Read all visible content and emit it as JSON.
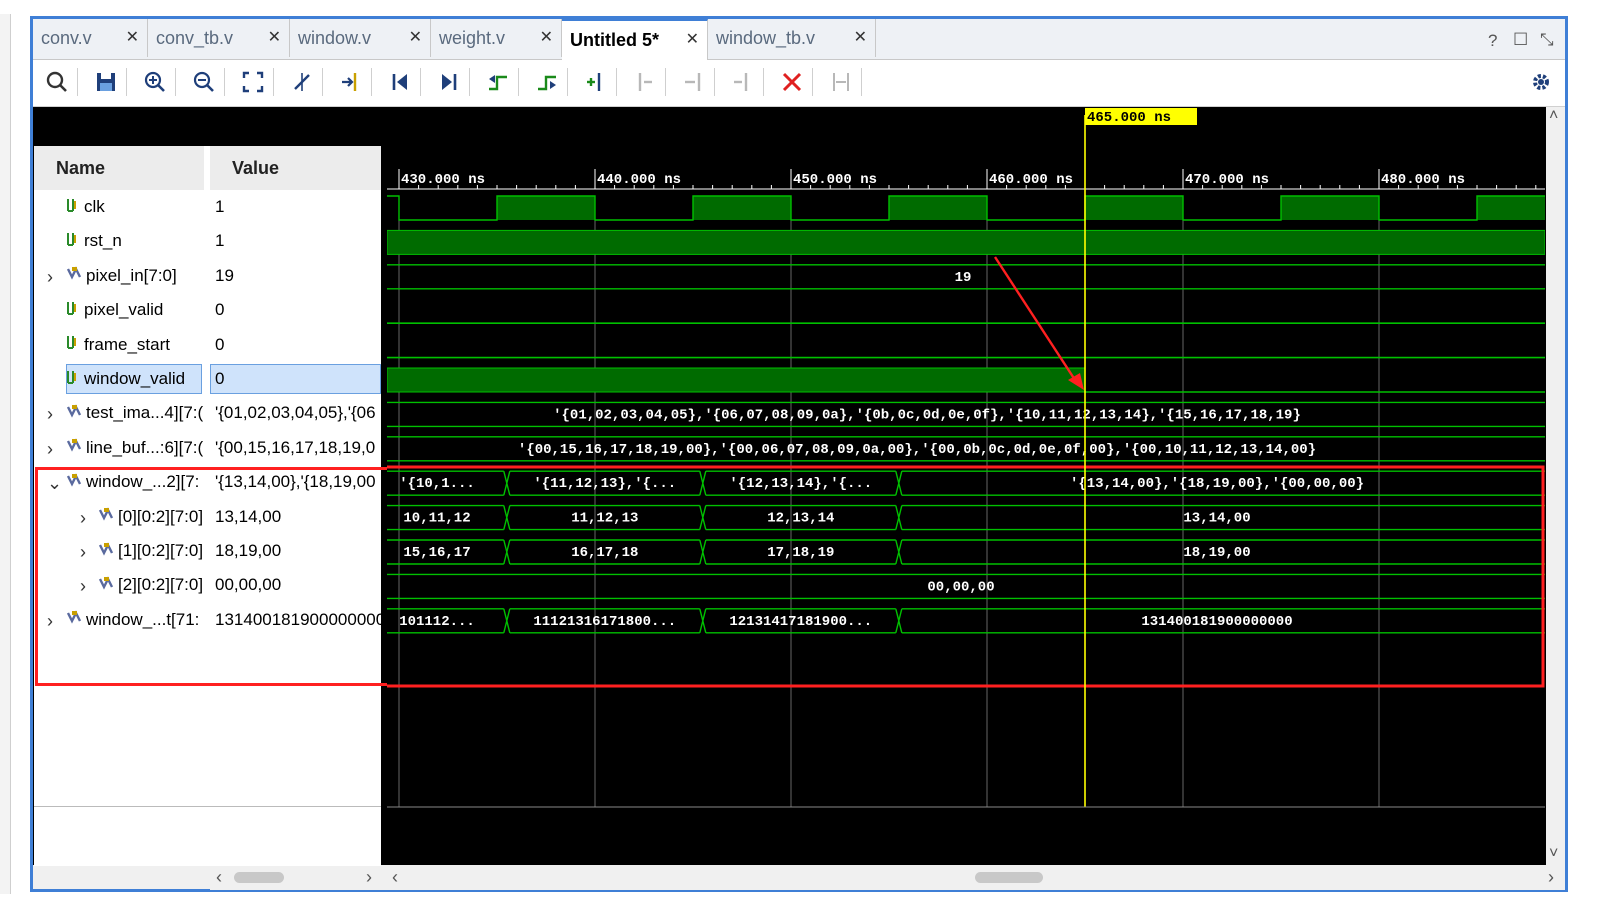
{
  "tabs": [
    {
      "label": "conv.v",
      "active": false
    },
    {
      "label": "conv_tb.v",
      "active": false
    },
    {
      "label": "window.v",
      "active": false
    },
    {
      "label": "weight.v",
      "active": false
    },
    {
      "label": "Untitled 5*",
      "active": true
    },
    {
      "label": "window_tb.v",
      "active": false
    }
  ],
  "tab_close": "✕",
  "window_controls": {
    "help": "?",
    "restore": "☐",
    "pin": "⤡"
  },
  "toolbar_icons": [
    "search-icon",
    "save-icon",
    "zoom-in-icon",
    "zoom-out-icon",
    "zoom-fit-icon",
    "cursor-icon",
    "goto-cursor-icon",
    "go-to-start-icon",
    "go-to-end-icon",
    "previous-transition-icon",
    "next-transition-icon",
    "add-marker-icon",
    "previous-marker-icon",
    "next-marker-icon",
    "delete-marker-icon",
    "delete-all-markers-icon",
    "swap-markers-icon",
    "settings-icon"
  ],
  "header": {
    "name": "Name",
    "value": "Value"
  },
  "cursor_label": "465.000 ns",
  "time_ticks": [
    "430.000 ns",
    "440.000 ns",
    "450.000 ns",
    "460.000 ns",
    "470.000 ns",
    "480.000 ns"
  ],
  "signals": [
    {
      "name": "clk",
      "value": "1",
      "type": "bit",
      "expandable": false
    },
    {
      "name": "rst_n",
      "value": "1",
      "type": "bit",
      "expandable": false
    },
    {
      "name": "pixel_in[7:0]",
      "value": "19",
      "type": "bus",
      "expandable": true
    },
    {
      "name": "pixel_valid",
      "value": "0",
      "type": "bit",
      "expandable": false
    },
    {
      "name": "frame_start",
      "value": "0",
      "type": "bit",
      "expandable": false
    },
    {
      "name": "window_valid",
      "value": "0",
      "type": "bit",
      "expandable": false,
      "selected": true
    },
    {
      "name": "test_ima...4][7:(",
      "value": "'{01,02,03,04,05},'{06",
      "type": "bus",
      "expandable": true
    },
    {
      "name": "line_buf...:6][7:(",
      "value": "'{00,15,16,17,18,19,0",
      "type": "bus",
      "expandable": true
    },
    {
      "name": "window_...2][7:",
      "value": "'{13,14,00},'{18,19,00",
      "type": "bus",
      "expandable": true,
      "expanded": true
    },
    {
      "name": "[0][0:2][7:0]",
      "value": "13,14,00",
      "type": "bus",
      "expandable": true,
      "child": true
    },
    {
      "name": "[1][0:2][7:0]",
      "value": "18,19,00",
      "type": "bus",
      "expandable": true,
      "child": true
    },
    {
      "name": "[2][0:2][7:0]",
      "value": "00,00,00",
      "type": "bus",
      "expandable": true,
      "child": true
    },
    {
      "name": "window_...t[71:",
      "value": "131400181900000000",
      "type": "bus",
      "expandable": true
    }
  ],
  "wave_labels": {
    "pixel_in": "19",
    "test_image": "'{01,02,03,04,05},'{06,07,08,09,0a},'{0b,0c,0d,0e,0f},'{10,11,12,13,14},'{15,16,17,18,19}",
    "line_buf": "'{00,15,16,17,18,19,00},'{00,06,07,08,09,0a,00},'{00,0b,0c,0d,0e,0f,00},'{00,10,11,12,13,14,00}",
    "window": [
      "'{10,1...",
      "'{11,12,13},'{...",
      "'{12,13,14},'{...",
      "'{13,14,00},'{18,19,00},'{00,00,00}"
    ],
    "w0": [
      "10,11,12",
      "11,12,13",
      "12,13,14",
      "13,14,00"
    ],
    "w1": [
      "15,16,17",
      "16,17,18",
      "17,18,19",
      "18,19,00"
    ],
    "w2": "00,00,00",
    "wflat": [
      "101112...",
      "11121316171800...",
      "12131417181900...",
      "131400181900000000"
    ]
  },
  "colors": {
    "wave_green": "#00c000",
    "fill_green": "#006b00",
    "cursor_yellow": "#ffff00",
    "highlight_red": "#ff2020",
    "accent_blue": "#3f7fd6"
  }
}
